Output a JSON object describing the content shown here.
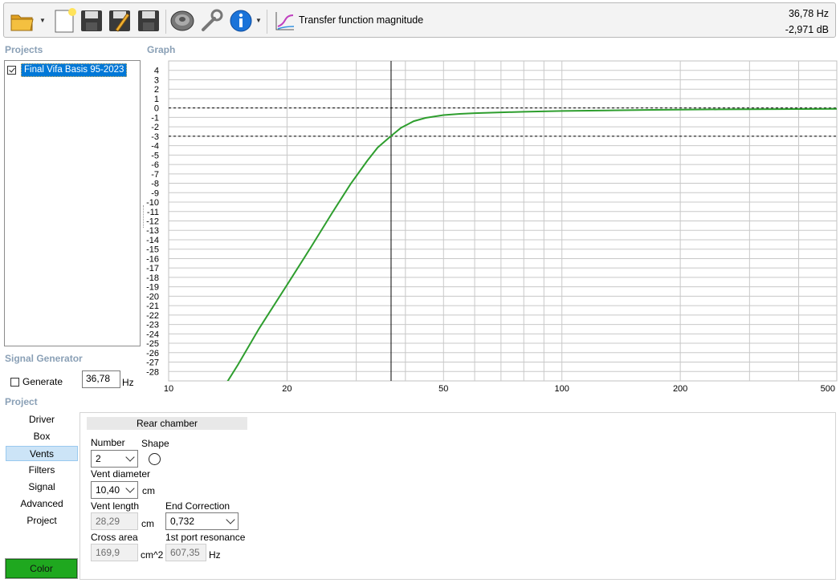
{
  "toolbar": {
    "title": "Transfer function magnitude",
    "readout_freq": "36,78 Hz",
    "readout_db": "-2,971 dB",
    "icons": [
      "open-folder-icon",
      "new-document-icon",
      "save-icon",
      "edit-save-icon",
      "save-as-icon",
      "speaker-icon",
      "settings-wrench-icon",
      "info-icon",
      "transfer-function-icon"
    ]
  },
  "sections": {
    "projects": "Projects",
    "graph": "Graph",
    "signal_generator": "Signal Generator",
    "project": "Project"
  },
  "projects": [
    {
      "name": "Final Vifa Basis 95-2023",
      "checked": true
    }
  ],
  "chart_data": {
    "type": "line",
    "title": "",
    "xlabel": "",
    "ylabel": "",
    "x_scale": "log",
    "xlim": [
      10,
      500
    ],
    "ylim": [
      -29,
      5
    ],
    "x_tick_labels": [
      "10",
      "20",
      "50",
      "100",
      "200",
      "500"
    ],
    "x_ticks": [
      10,
      20,
      50,
      100,
      200,
      500
    ],
    "y_tick_labels": [
      "4",
      "3",
      "2",
      "1",
      "0",
      "-1",
      "-2",
      "-3",
      "-4",
      "-5",
      "-6",
      "-7",
      "-8",
      "-9",
      "-10",
      "-11",
      "-12",
      "-13",
      "-14",
      "-15",
      "-16",
      "-17",
      "-18",
      "-19",
      "-20",
      "-21",
      "-22",
      "-23",
      "-24",
      "-25",
      "-26",
      "-27",
      "-28"
    ],
    "grid": true,
    "cursor_x": 36.78,
    "reference_lines_y": [
      0,
      -3
    ],
    "series": [
      {
        "color": "#2e9e2e",
        "x": [
          13.9,
          15,
          17,
          20,
          23,
          26,
          29,
          32,
          34,
          36.78,
          39,
          42,
          45,
          50,
          55,
          60,
          70,
          80,
          100,
          130,
          170,
          250,
          350,
          500
        ],
        "y": [
          -29.5,
          -27.3,
          -23.4,
          -18.8,
          -14.8,
          -11.2,
          -8.1,
          -5.6,
          -4.2,
          -2.97,
          -2.1,
          -1.4,
          -1.05,
          -0.75,
          -0.62,
          -0.55,
          -0.46,
          -0.4,
          -0.32,
          -0.26,
          -0.2,
          -0.15,
          -0.12,
          -0.1
        ]
      }
    ]
  },
  "signal_generator": {
    "generate_label": "Generate",
    "generate_checked": false,
    "frequency_value": "36,78",
    "frequency_unit": "Hz"
  },
  "nav": {
    "items": [
      "Driver",
      "Box",
      "Vents",
      "Filters",
      "Signal",
      "Advanced",
      "Project"
    ],
    "active": "Vents",
    "color_button": "Color",
    "color_button_color": "#1fa81f"
  },
  "vents": {
    "header": "Rear chamber",
    "number_label": "Number",
    "number_value": "2",
    "shape_label": "Shape",
    "shape_value": "circle",
    "vent_diameter_label": "Vent diameter",
    "vent_diameter_value": "10,40",
    "vent_diameter_unit": "cm",
    "vent_length_label": "Vent length",
    "vent_length_value": "28,29",
    "vent_length_unit": "cm",
    "end_correction_label": "End Correction",
    "end_correction_value": "0,732",
    "cross_area_label": "Cross area",
    "cross_area_value": "169,9",
    "cross_area_unit": "cm^2",
    "port_resonance_label": "1st port resonance",
    "port_resonance_value": "607,35",
    "port_resonance_unit": "Hz"
  }
}
